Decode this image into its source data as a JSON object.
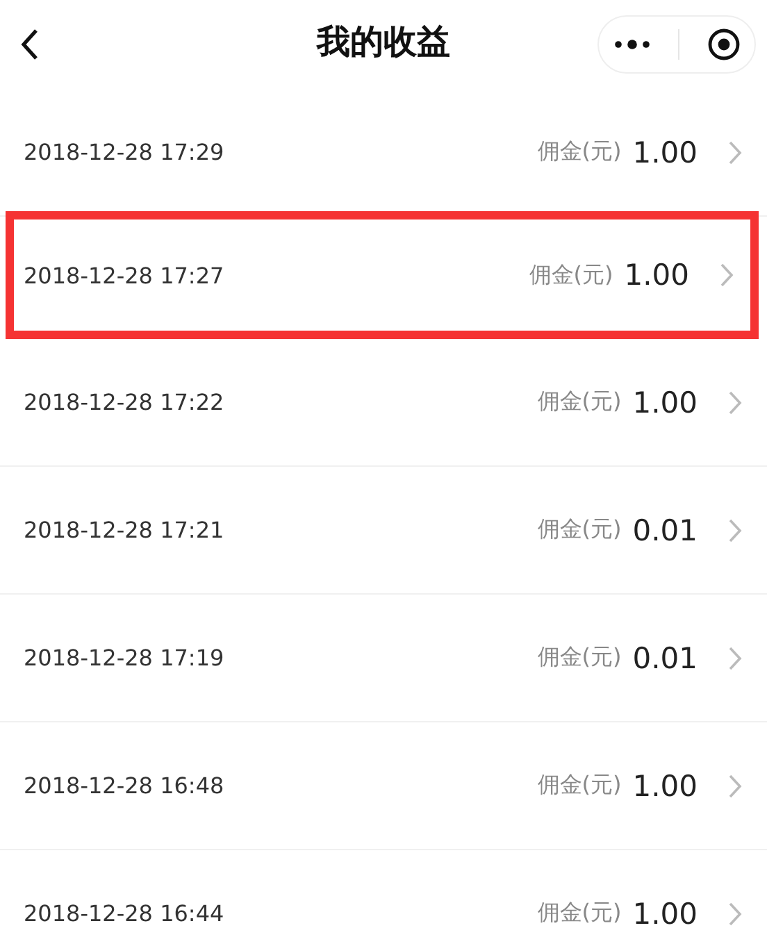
{
  "header": {
    "title": "我的收益"
  },
  "rows": [
    {
      "time": "2018-12-28 17:29",
      "label": "佣金(元)",
      "amount": "1.00",
      "highlighted": false
    },
    {
      "time": "2018-12-28 17:27",
      "label": "佣金(元)",
      "amount": "1.00",
      "highlighted": true
    },
    {
      "time": "2018-12-28 17:22",
      "label": "佣金(元)",
      "amount": "1.00",
      "highlighted": false
    },
    {
      "time": "2018-12-28 17:21",
      "label": "佣金(元)",
      "amount": "0.01",
      "highlighted": false
    },
    {
      "time": "2018-12-28 17:19",
      "label": "佣金(元)",
      "amount": "0.01",
      "highlighted": false
    },
    {
      "time": "2018-12-28 16:48",
      "label": "佣金(元)",
      "amount": "1.00",
      "highlighted": false
    },
    {
      "time": "2018-12-28 16:44",
      "label": "佣金(元)",
      "amount": "1.00",
      "highlighted": false
    }
  ]
}
